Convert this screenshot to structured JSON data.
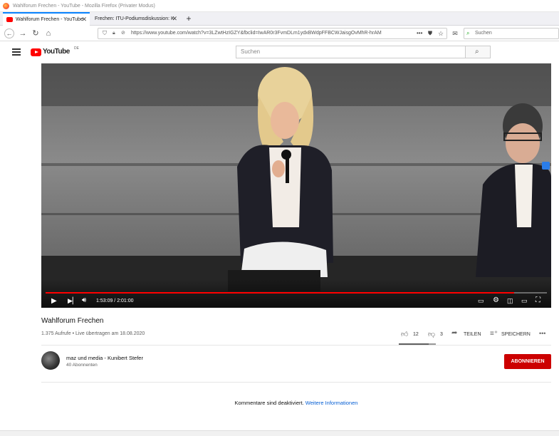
{
  "window": {
    "title": "Wahlforum Frechen - YouTube - Mozilla Firefox (Privater Modus)"
  },
  "tabs": [
    {
      "label": "Wahlforum Frechen - YouTube"
    },
    {
      "label": "Frechen: ITU-Podiumsdiskussion: K"
    }
  ],
  "browser": {
    "url": "https://www.youtube.com/watch?v=3LZwtHzIGZY&fbclid=IwAR0r3FvmDLm1ydxBWdpFFBCWJaisgOvMhR-hrAM",
    "search_placeholder": "Suchen"
  },
  "youtube": {
    "logo_text": "YouTube",
    "region": "DE",
    "search_placeholder": "Suchen"
  },
  "player": {
    "time": "1:53:09 / 2:01:00",
    "progress": 0.935
  },
  "video": {
    "title": "Wahlforum Frechen",
    "meta": "1.375 Aufrufe • Live übertragen am 18.08.2020",
    "likes": "12",
    "dislikes": "3",
    "share_label": "TEILEN",
    "save_label": "SPEICHERN"
  },
  "channel": {
    "name": "maz und media - Kunibert Stefer",
    "subscribers": "40 Abonnenten",
    "subscribe_label": "ABONNIEREN"
  },
  "comments": {
    "notice": "Kommentare sind deaktiviert.",
    "link": "Weitere Informationen"
  },
  "colors": {
    "youtube_red": "#ff0000",
    "subscribe_bg": "#cc0000",
    "link_blue": "#065fd4",
    "firefox_accent": "#0a84ff"
  }
}
